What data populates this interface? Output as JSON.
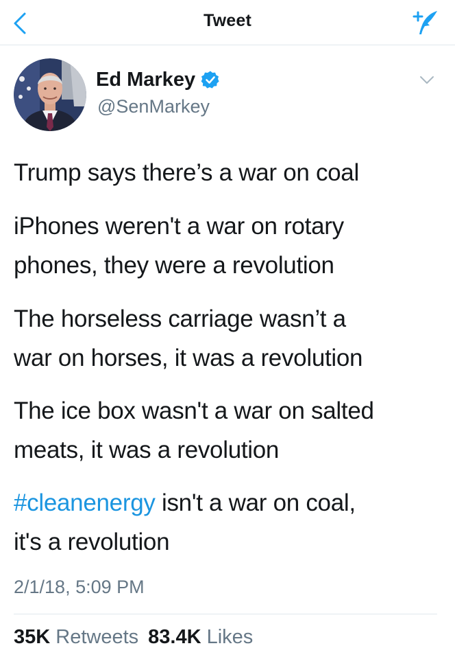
{
  "nav": {
    "title": "Tweet",
    "back_icon": "chevron-left-icon",
    "compose_icon": "compose-tweet-icon"
  },
  "author": {
    "name": "Ed Markey",
    "handle": "@SenMarkey",
    "verified_icon": "verified-badge-icon",
    "menu_icon": "chevron-down-icon"
  },
  "tweet": {
    "line1": "Trump says there’s a war on coal",
    "line2": "iPhones weren't a war on rotary",
    "line3": "phones, they were a revolution",
    "line4": "The horseless carriage wasn’t a",
    "line5": "war on horses, it was a revolution",
    "line6": "The ice box wasn't a war on salted",
    "line7": "meats, it was a revolution",
    "line8_hashtag": "#cleanenergy",
    "line8_rest": " isn't a war on coal,",
    "line9": "it's a revolution",
    "timestamp": "2/1/18, 5:09 PM"
  },
  "stats": {
    "retweets_count": "35K",
    "retweets_label": "Retweets",
    "likes_count": "83.4K",
    "likes_label": "Likes"
  },
  "colors": {
    "accent": "#1DA1F2",
    "hashtag": "#1B95E0",
    "secondary_text": "#657786",
    "primary_text": "#14171A"
  }
}
